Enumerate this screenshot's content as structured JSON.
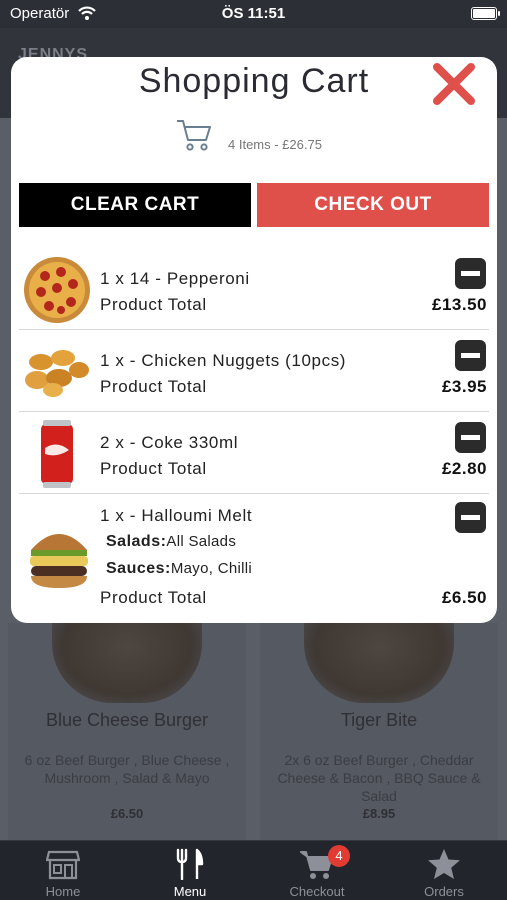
{
  "status_bar": {
    "carrier": "Operatör",
    "time": "ÖS 11:51"
  },
  "background": {
    "logo": "JENNYS",
    "cards": [
      {
        "name": "Blue Cheese Burger",
        "description": "6 oz Beef Burger , Blue Cheese , Mushroom , Salad & Mayo",
        "price": "£6.50"
      },
      {
        "name": "Tiger Bite",
        "description": "2x 6 oz Beef Burger , Cheddar Cheese & Bacon , BBQ Sauce & Salad",
        "price": "£8.95"
      }
    ]
  },
  "modal": {
    "title": "Shopping Cart",
    "summary": "4 Items - £26.75",
    "clear_label": "CLEAR CART",
    "checkout_label": "CHECK OUT",
    "items": [
      {
        "line": "1 x 14 - Pepperoni",
        "total_label": "Product Total",
        "price": "£13.50",
        "image": "pizza"
      },
      {
        "line": "1 x - Chicken Nuggets (10pcs)",
        "total_label": "Product Total",
        "price": "£3.95",
        "image": "nuggets"
      },
      {
        "line": "2 x - Coke 330ml",
        "total_label": "Product Total",
        "price": "£2.80",
        "image": "coke-can"
      },
      {
        "line": "1 x - Halloumi Melt",
        "total_label": "Product Total",
        "price": "£6.50",
        "image": "burger",
        "options": [
          {
            "label": "Salads:",
            "value": "All Salads"
          },
          {
            "label": "Sauces:",
            "value": "Mayo, Chilli"
          }
        ]
      }
    ]
  },
  "tabbar": {
    "tabs": [
      {
        "label": "Home",
        "icon": "store-icon"
      },
      {
        "label": "Menu",
        "icon": "fork-knife-icon",
        "active": true
      },
      {
        "label": "Checkout",
        "icon": "cart-icon",
        "badge": "4"
      },
      {
        "label": "Orders",
        "icon": "star-icon"
      }
    ]
  },
  "colors": {
    "accent_red": "#e0504b",
    "badge_red": "#e23b33",
    "tabbar_bg": "#22252b"
  }
}
